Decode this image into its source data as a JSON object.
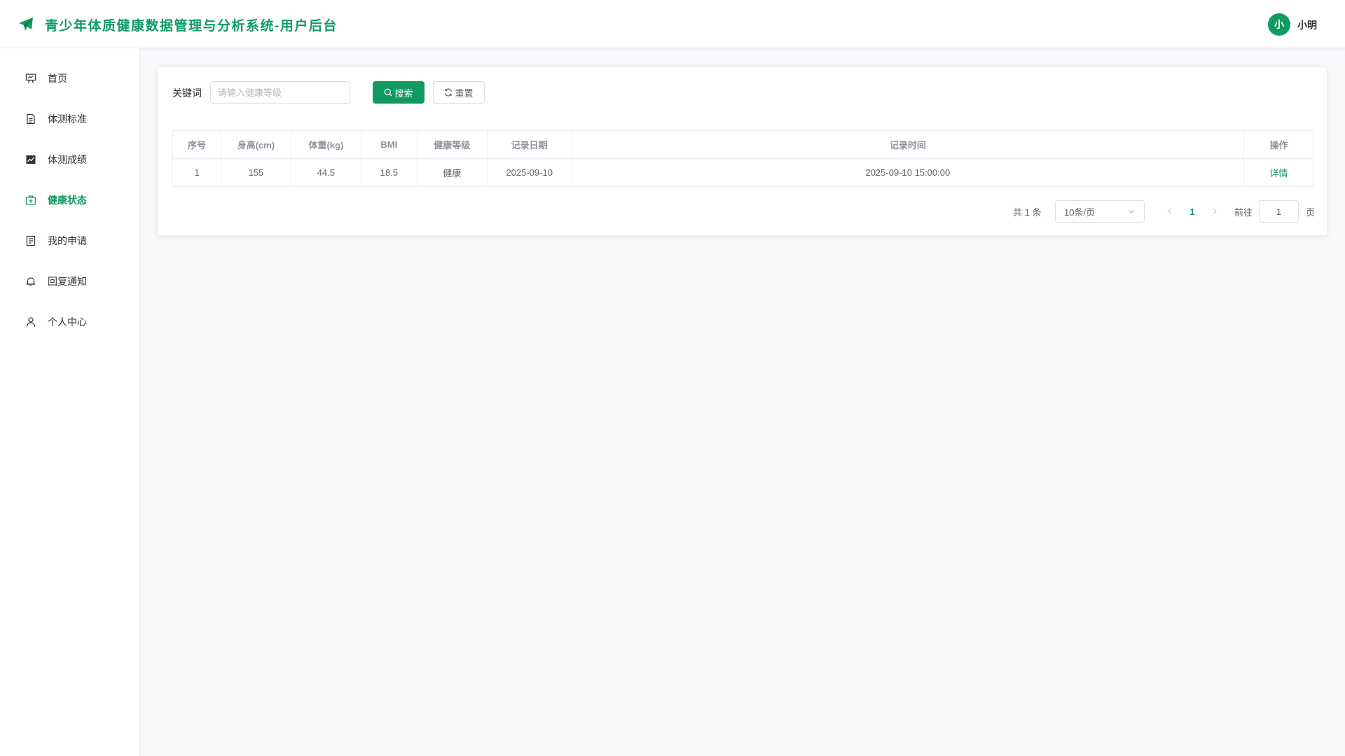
{
  "app": {
    "title": "青少年体质健康数据管理与分析系统-用户后台",
    "brand_color": "#109a62"
  },
  "user": {
    "avatar_text": "小",
    "name": "小明"
  },
  "sidebar": {
    "items": [
      {
        "label": "首页",
        "icon": "presentation-chart-icon",
        "active": false
      },
      {
        "label": "体测标准",
        "icon": "document-icon",
        "active": false
      },
      {
        "label": "体测成绩",
        "icon": "trend-chart-icon",
        "active": false
      },
      {
        "label": "健康状态",
        "icon": "first-aid-kit-icon",
        "active": true
      },
      {
        "label": "我的申请",
        "icon": "tickets-icon",
        "active": false
      },
      {
        "label": "回复通知",
        "icon": "bell-icon",
        "active": false
      },
      {
        "label": "个人中心",
        "icon": "user-icon",
        "active": false
      }
    ]
  },
  "search": {
    "keyword_label": "关键词",
    "placeholder": "请输入健康等级",
    "value": "",
    "search_label": "搜索",
    "reset_label": "重置"
  },
  "table": {
    "columns": [
      "序号",
      "身高(cm)",
      "体重(kg)",
      "BMI",
      "健康等级",
      "记录日期",
      "记录时间",
      "操作"
    ],
    "rows": [
      {
        "index": "1",
        "height": "155",
        "weight": "44.5",
        "bmi": "18.5",
        "level": "健康",
        "date": "2025-09-10",
        "time": "2025-09-10 15:00:00",
        "action": "详情"
      }
    ]
  },
  "pagination": {
    "total_text": "共 1 条",
    "page_size": "10条/页",
    "current_page": "1",
    "goto_label": "前往",
    "goto_value": "1",
    "page_unit": "页"
  }
}
